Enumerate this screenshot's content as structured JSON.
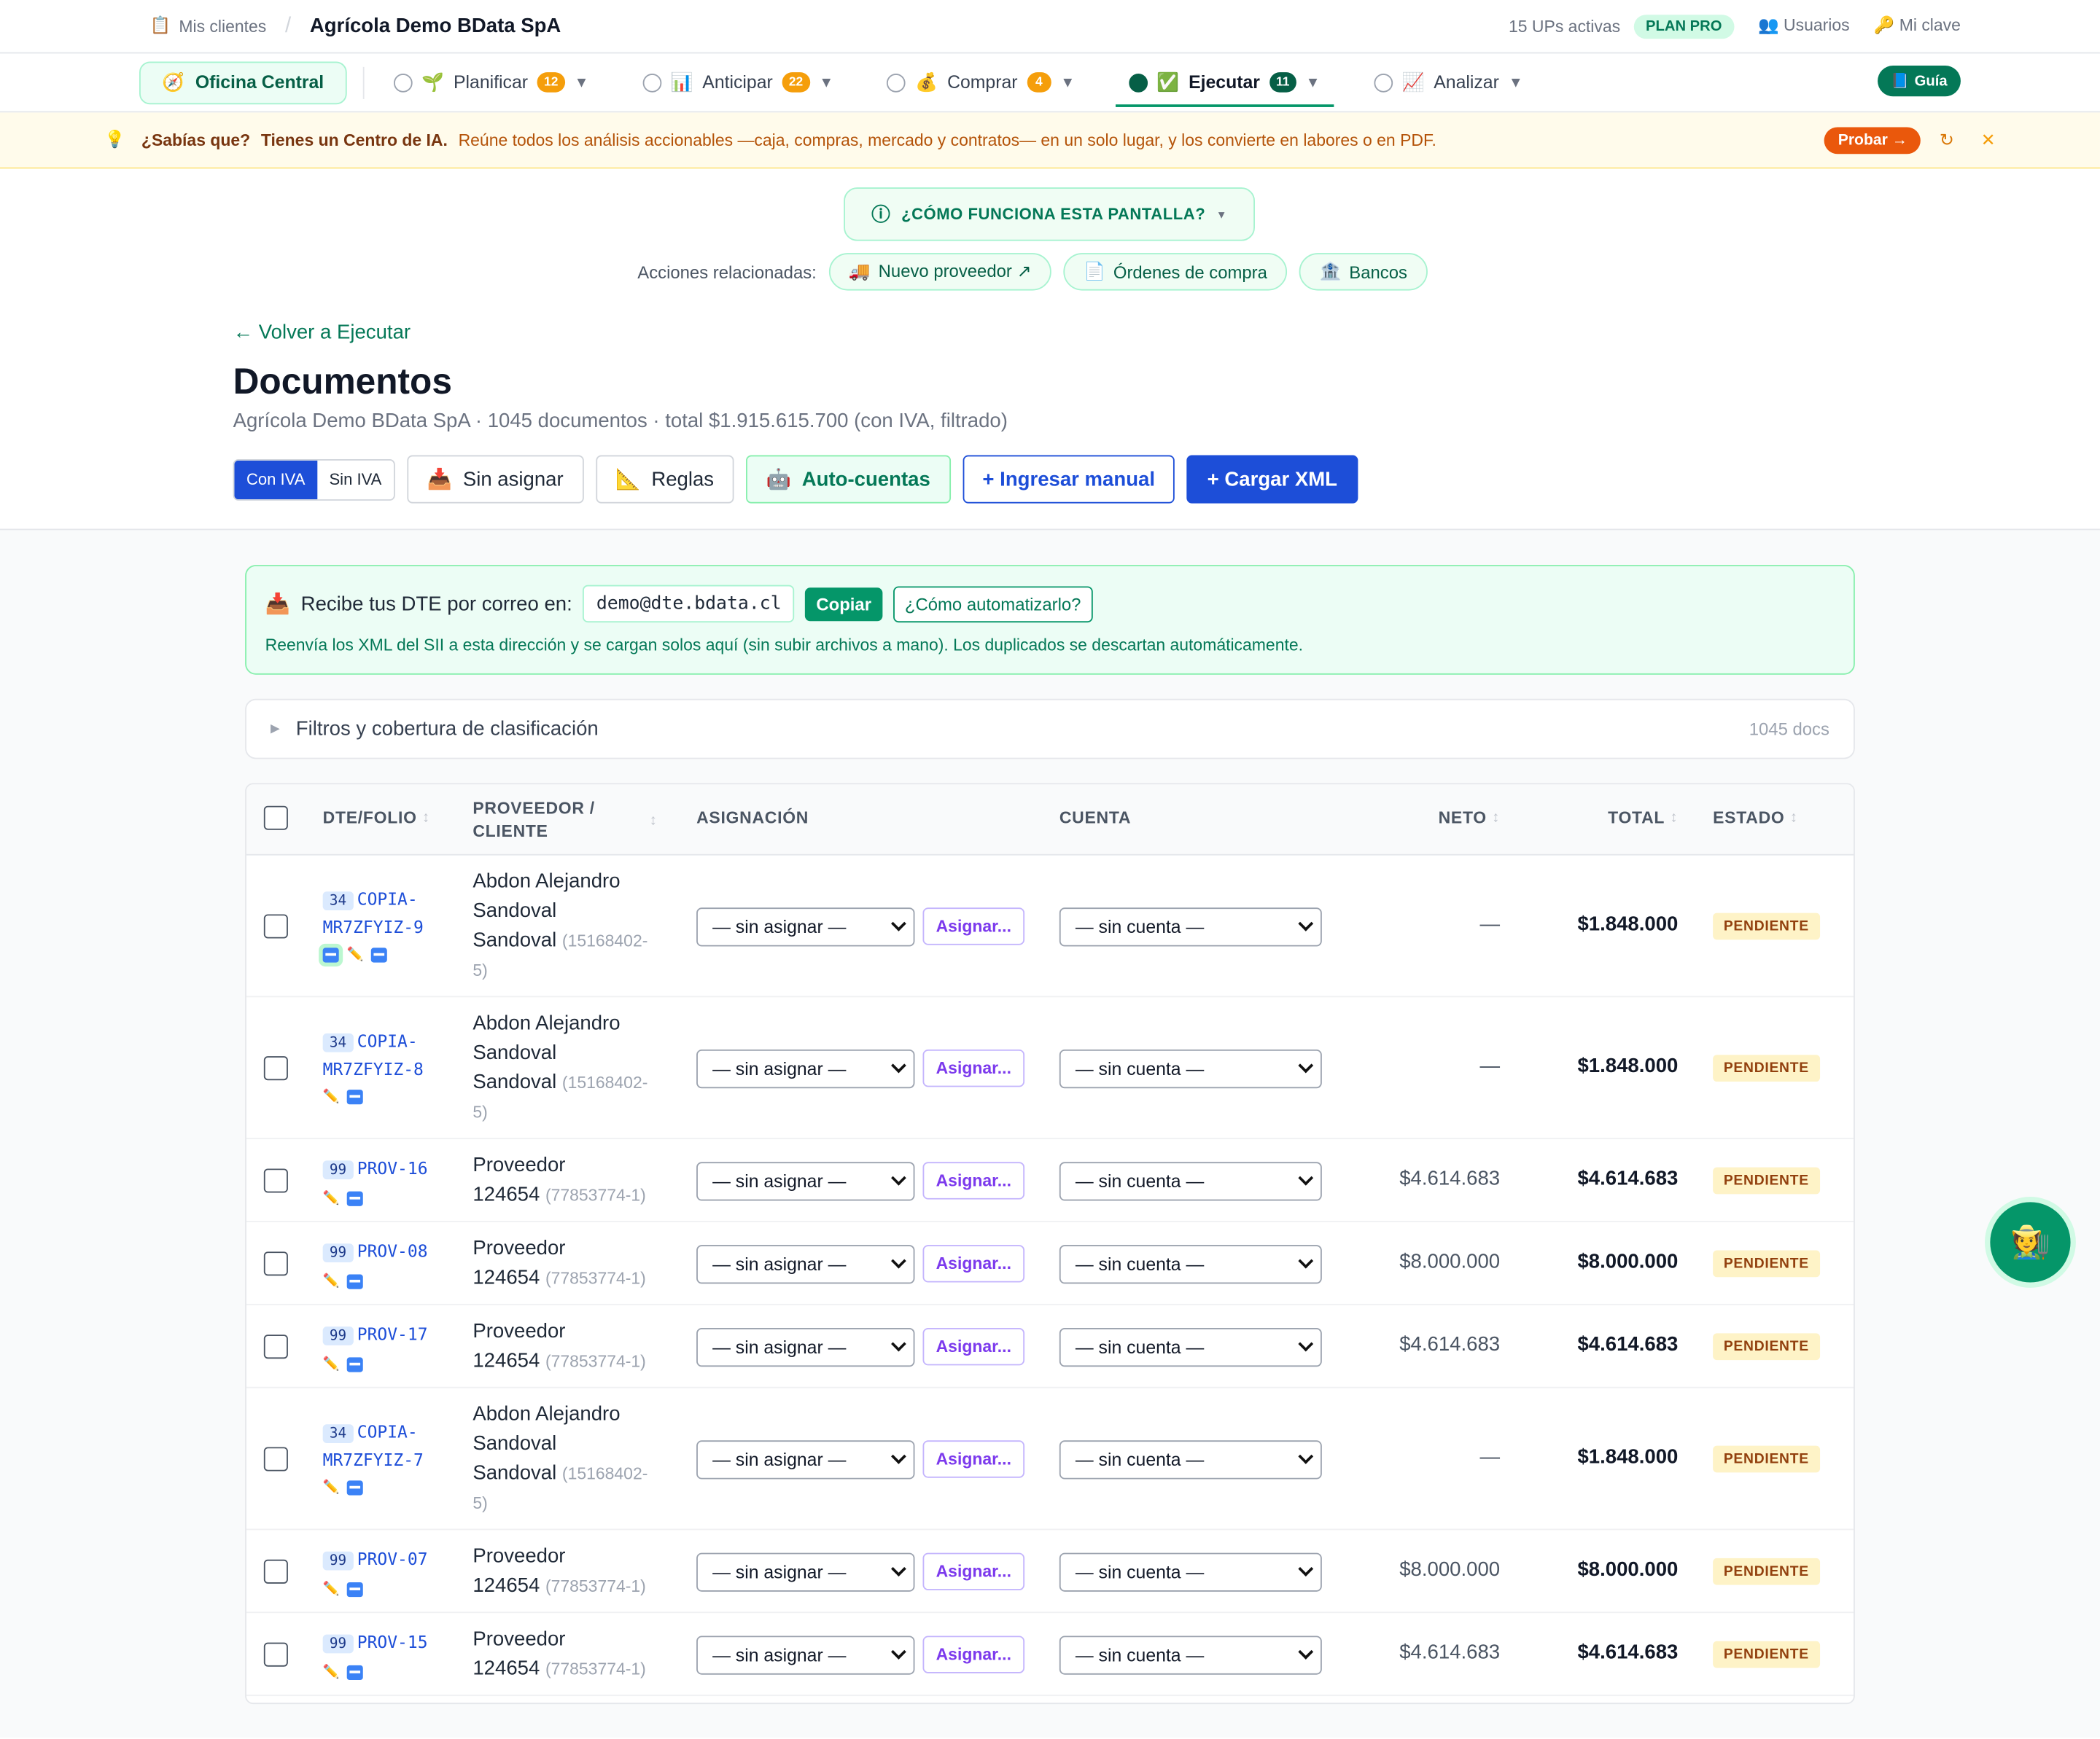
{
  "topbar": {
    "clients": "Mis clientes",
    "company": "Agrícola Demo BData SpA",
    "ups": "15 UPs activas",
    "plan": "PLAN PRO",
    "users": "Usuarios",
    "key": "Mi clave"
  },
  "nav": {
    "office": "Oficina Central",
    "tabs": [
      {
        "n": "①",
        "label": "Planificar",
        "badge": "12",
        "icon": "🌱"
      },
      {
        "n": "②",
        "label": "Anticipar",
        "badge": "22",
        "icon": "📊"
      },
      {
        "n": "③",
        "label": "Comprar",
        "badge": "4",
        "icon": "💰"
      },
      {
        "n": "④",
        "label": "Ejecutar",
        "badge": "11",
        "icon": "✅"
      },
      {
        "n": "⑤",
        "label": "Analizar",
        "badge": "",
        "icon": "📈"
      }
    ],
    "guide": "Guía"
  },
  "tip": {
    "lead": "¿Sabías que?",
    "title": "Tienes un Centro de IA.",
    "msg": "Reúne todos los análisis accionables —caja, compras, mercado y contratos— en un solo lugar, y los convierte en labores o en PDF.",
    "try": "Probar →"
  },
  "howto": "¿CÓMO FUNCIONA ESTA PANTALLA?",
  "related": {
    "label": "Acciones relacionadas:",
    "chips": [
      "Nuevo proveedor ↗",
      "Órdenes de compra",
      "Bancos"
    ]
  },
  "page": {
    "back": "← Volver a Ejecutar",
    "title": "Documentos",
    "subtitle": "Agrícola Demo BData SpA · 1045 documentos · total $1.915.615.700 (con IVA, filtrado)"
  },
  "actions": {
    "con_iva": "Con IVA",
    "sin_iva": "Sin IVA",
    "unassigned": "Sin asignar",
    "rules": "Reglas",
    "auto": "Auto-cuentas",
    "manual": "+ Ingresar manual",
    "xml": "+ Cargar XML"
  },
  "mailbox": {
    "label": "Recibe tus DTE por correo en:",
    "address": "demo@dte.bdata.cl",
    "copy": "Copiar",
    "how": "¿Cómo automatizarlo?",
    "note": "Reenvía los XML del SII a esta dirección y se cargan solos aquí (sin subir archivos a mano). Los duplicados se descartan automáticamente."
  },
  "filters": {
    "label": "Filtros y cobertura de clasificación",
    "count": "1045 docs"
  },
  "table": {
    "headers": {
      "folio": "DTE/FOLIO",
      "prov1": "PROVEEDOR /",
      "prov2": "CLIENTE",
      "asig": "ASIGNACIÓN",
      "cuenta": "CUENTA",
      "neto": "NETO",
      "total": "TOTAL",
      "estado": "ESTADO"
    },
    "select_placeholder": "— sin asignar —",
    "assign_btn": "Asignar...",
    "account_placeholder": "— sin cuenta —",
    "rows": [
      {
        "type": "34",
        "folio1": "COPIA-",
        "folio2": "MR7ZFYIZ-9",
        "prov": [
          "Abdon Alejandro",
          "Sandoval",
          "Sandoval"
        ],
        "rut1": "(15168402-",
        "rut2": "5)",
        "neto": "—",
        "total": "$1.848.000",
        "estado": "PENDIENTE"
      },
      {
        "type": "34",
        "folio1": "COPIA-",
        "folio2": "MR7ZFYIZ-8",
        "prov": [
          "Abdon Alejandro",
          "Sandoval",
          "Sandoval"
        ],
        "rut1": "(15168402-",
        "rut2": "5)",
        "neto": "—",
        "total": "$1.848.000",
        "estado": "PENDIENTE"
      },
      {
        "type": "99",
        "folio1": "PROV-16",
        "folio2": "",
        "prov": [
          "Proveedor",
          "124654"
        ],
        "rut1": "(77853774-1)",
        "rut2": "",
        "neto": "$4.614.683",
        "total": "$4.614.683",
        "estado": "PENDIENTE"
      },
      {
        "type": "99",
        "folio1": "PROV-08",
        "folio2": "",
        "prov": [
          "Proveedor",
          "124654"
        ],
        "rut1": "(77853774-1)",
        "rut2": "",
        "neto": "$8.000.000",
        "total": "$8.000.000",
        "estado": "PENDIENTE"
      },
      {
        "type": "99",
        "folio1": "PROV-17",
        "folio2": "",
        "prov": [
          "Proveedor",
          "124654"
        ],
        "rut1": "(77853774-1)",
        "rut2": "",
        "neto": "$4.614.683",
        "total": "$4.614.683",
        "estado": "PENDIENTE"
      },
      {
        "type": "34",
        "folio1": "COPIA-",
        "folio2": "MR7ZFYIZ-7",
        "prov": [
          "Abdon Alejandro",
          "Sandoval",
          "Sandoval"
        ],
        "rut1": "(15168402-",
        "rut2": "5)",
        "neto": "—",
        "total": "$1.848.000",
        "estado": "PENDIENTE"
      },
      {
        "type": "99",
        "folio1": "PROV-07",
        "folio2": "",
        "prov": [
          "Proveedor",
          "124654"
        ],
        "rut1": "(77853774-1)",
        "rut2": "",
        "neto": "$8.000.000",
        "total": "$8.000.000",
        "estado": "PENDIENTE"
      },
      {
        "type": "99",
        "folio1": "PROV-15",
        "folio2": "",
        "prov": [
          "Proveedor",
          "124654"
        ],
        "rut1": "(77853774-1)",
        "rut2": "",
        "neto": "$4.614.683",
        "total": "$4.614.683",
        "estado": "PENDIENTE"
      }
    ]
  },
  "fab_icon": "🧑‍🌾"
}
